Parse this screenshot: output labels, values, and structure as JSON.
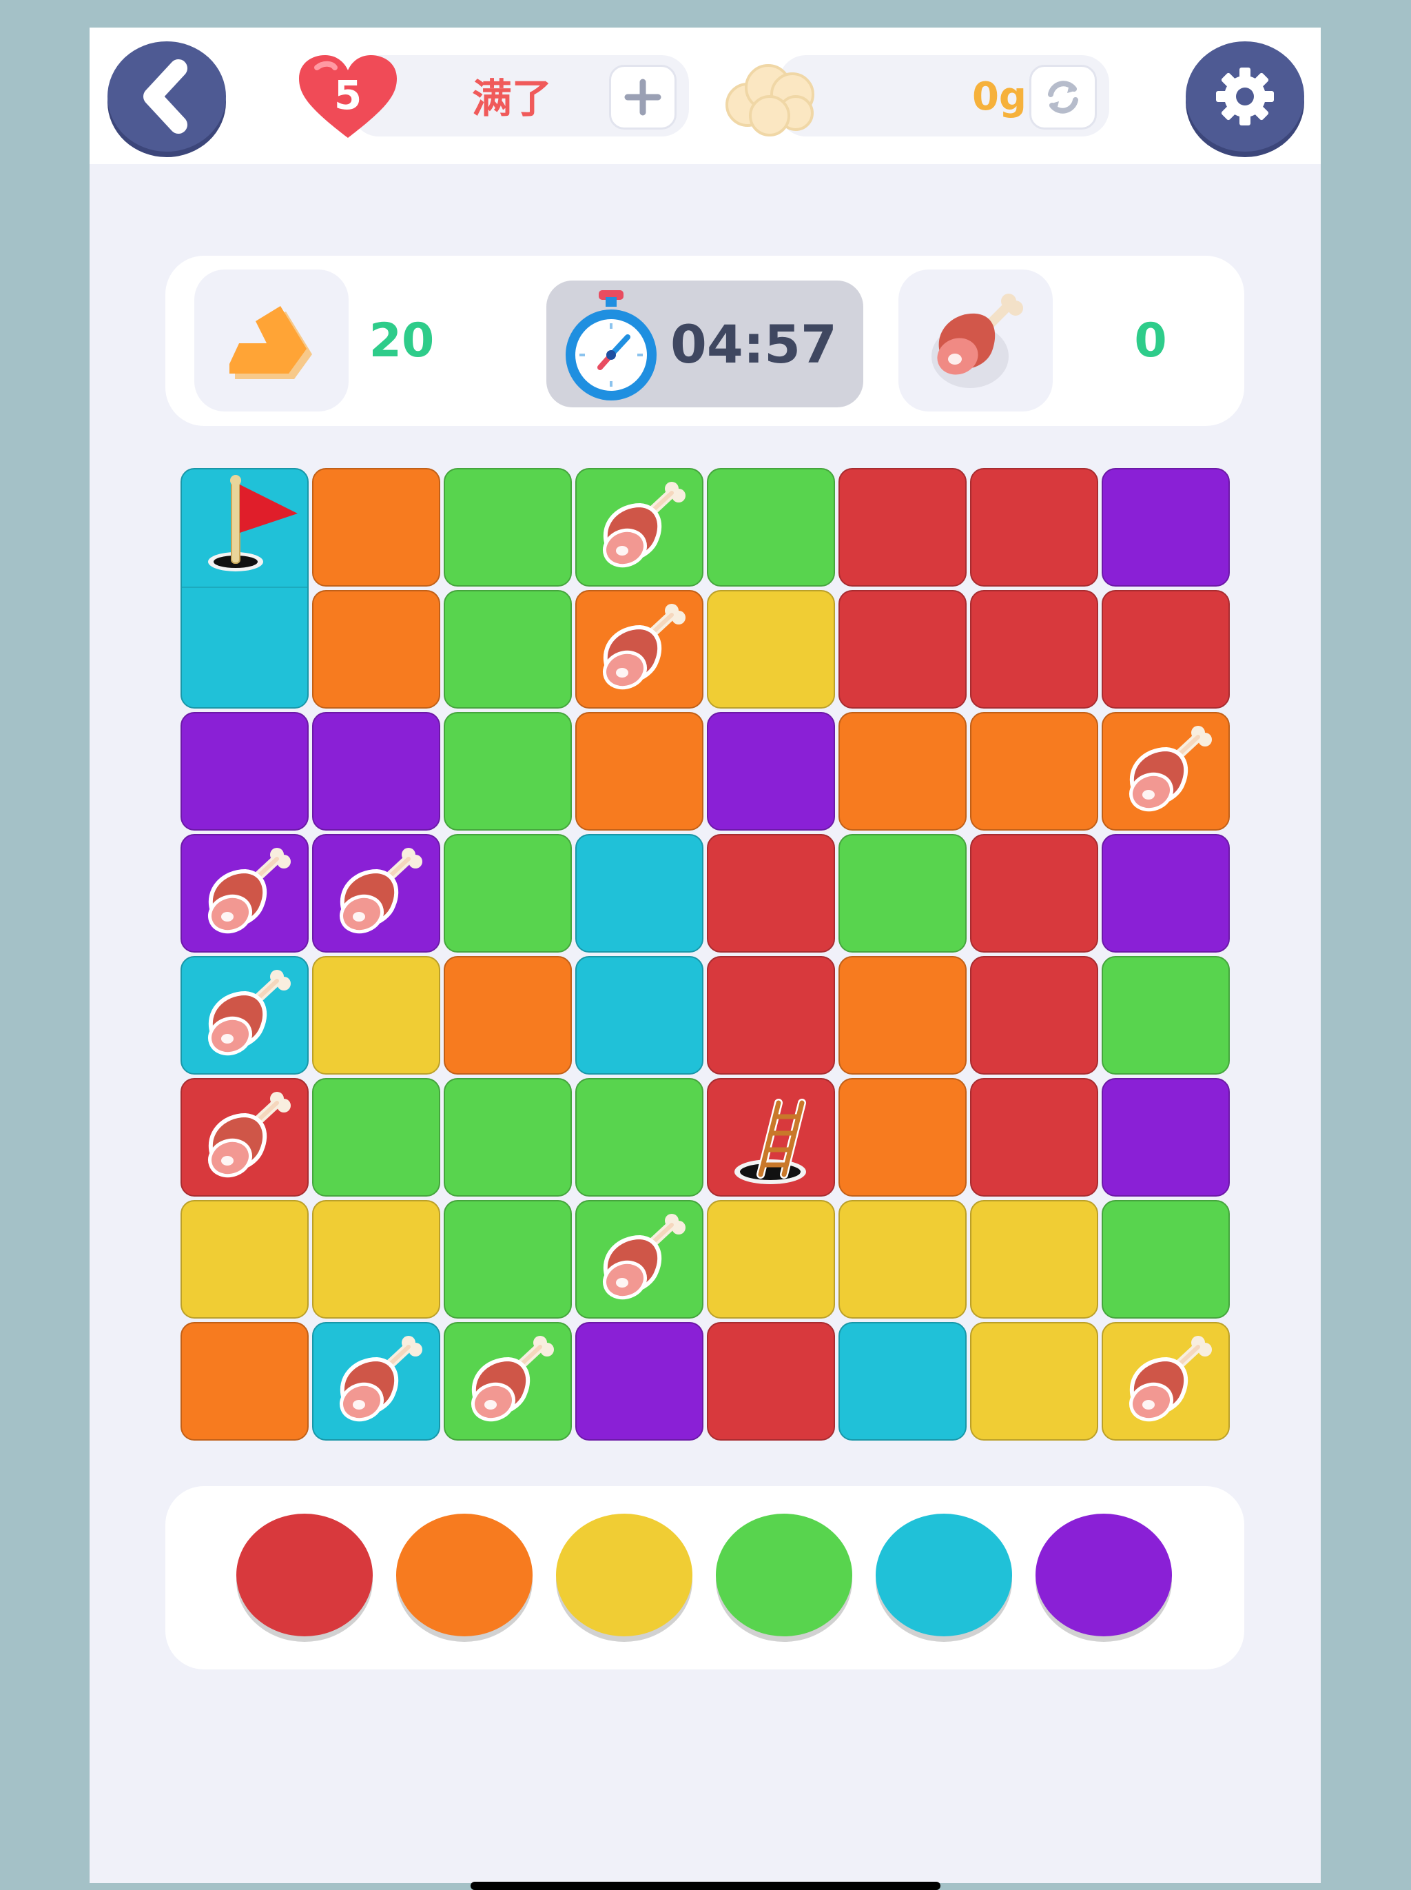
{
  "topbar": {
    "lives_count": "5",
    "lives_status": "满了",
    "grams": "0g",
    "icons": {
      "back": "chevron-left-icon",
      "heart": "heart-icon",
      "plus": "plus-icon",
      "cloud": "cloud-icon",
      "refresh": "refresh-icon",
      "settings": "gear-icon"
    }
  },
  "stats": {
    "moves_left": "20",
    "timer": "04:57",
    "meat_collected": "0",
    "icons": {
      "moves": "arrow-turn-icon",
      "timer": "stopwatch-icon",
      "meat": "meat-icon"
    }
  },
  "colors": {
    "red": "#d8393d",
    "orange": "#f77b1f",
    "yellow": "#f0cd34",
    "green": "#58d44e",
    "cyan": "#20c1d8",
    "purple": "#8a20d6"
  },
  "board": {
    "rows": [
      [
        "cyan",
        "orange",
        "green",
        "green",
        "green",
        "red",
        "red",
        "purple"
      ],
      [
        "cyan",
        "orange",
        "green",
        "orange",
        "yellow",
        "red",
        "red",
        "red"
      ],
      [
        "purple",
        "purple",
        "green",
        "orange",
        "purple",
        "orange",
        "orange",
        "orange"
      ],
      [
        "purple",
        "purple",
        "green",
        "cyan",
        "red",
        "green",
        "red",
        "purple"
      ],
      [
        "cyan",
        "yellow",
        "orange",
        "cyan",
        "red",
        "orange",
        "red",
        "green"
      ],
      [
        "red",
        "green",
        "green",
        "green",
        "red",
        "orange",
        "red",
        "purple"
      ],
      [
        "yellow",
        "yellow",
        "green",
        "green",
        "yellow",
        "yellow",
        "yellow",
        "green"
      ],
      [
        "orange",
        "cyan",
        "green",
        "purple",
        "red",
        "cyan",
        "yellow",
        "yellow"
      ]
    ],
    "items": [
      {
        "row": 0,
        "col": 0,
        "type": "flag"
      },
      {
        "row": 0,
        "col": 3,
        "type": "meat"
      },
      {
        "row": 1,
        "col": 3,
        "type": "meat"
      },
      {
        "row": 2,
        "col": 7,
        "type": "meat"
      },
      {
        "row": 3,
        "col": 0,
        "type": "meat"
      },
      {
        "row": 3,
        "col": 1,
        "type": "meat"
      },
      {
        "row": 4,
        "col": 0,
        "type": "meat"
      },
      {
        "row": 5,
        "col": 0,
        "type": "meat"
      },
      {
        "row": 5,
        "col": 4,
        "type": "ladder"
      },
      {
        "row": 6,
        "col": 3,
        "type": "meat"
      },
      {
        "row": 7,
        "col": 1,
        "type": "meat"
      },
      {
        "row": 7,
        "col": 2,
        "type": "meat"
      },
      {
        "row": 7,
        "col": 7,
        "type": "meat"
      }
    ],
    "merged": [
      {
        "col": 0,
        "row": 0,
        "span": 2,
        "color": "cyan"
      }
    ]
  },
  "palette": [
    "red",
    "orange",
    "yellow",
    "green",
    "cyan",
    "purple"
  ]
}
